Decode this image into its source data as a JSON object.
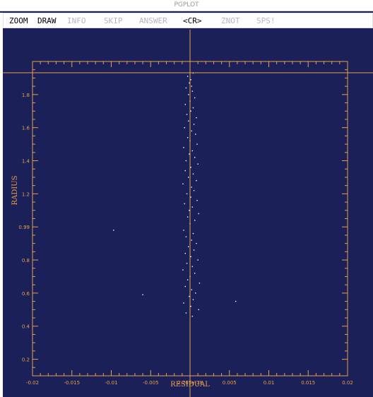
{
  "window": {
    "title": "PGPLOT"
  },
  "menu": [
    {
      "label": "ZOOM",
      "dim": false
    },
    {
      "label": "DRAW",
      "dim": false
    },
    {
      "label": "INFO",
      "dim": true
    },
    {
      "label": "SKIP",
      "dim": true
    },
    {
      "label": "ANSWER",
      "dim": true
    },
    {
      "label": "<CR>",
      "dim": false
    },
    {
      "label": "ZNOT",
      "dim": true
    },
    {
      "label": "SPS!",
      "dim": true
    }
  ],
  "chart_data": {
    "type": "scatter",
    "xlabel": "RESIDUAL",
    "ylabel": "RADIUS",
    "xlim": [
      -0.02,
      0.02
    ],
    "ylim": [
      0.1,
      2.0
    ],
    "x_tick_labels": [
      "-0.02",
      "-0.015",
      "-0.01",
      "-0.005",
      "2.765e-18",
      "0.005",
      "0.01",
      "0.015",
      "0.02"
    ],
    "y_tick_labels": [
      "0.2",
      "0.4",
      "0.6",
      "0.8",
      "0.99",
      "1.2",
      "1.4",
      "1.6",
      "1.8"
    ],
    "cursor": {
      "x": 0.0,
      "y": 2.0
    },
    "colors": {
      "background": "#1b2058",
      "axes": "#e8a04a",
      "points": "#ffffff"
    },
    "points": [
      [
        0.0004,
        1.93
      ],
      [
        -0.0003,
        1.91
      ],
      [
        0.0001,
        1.89
      ],
      [
        -0.0001,
        1.87
      ],
      [
        0.0002,
        1.85
      ],
      [
        -0.0005,
        1.84
      ],
      [
        0.0003,
        1.82
      ],
      [
        -0.0002,
        1.8
      ],
      [
        0.0006,
        1.78
      ],
      [
        0.0,
        1.76
      ],
      [
        -0.0006,
        1.74
      ],
      [
        0.0004,
        1.72
      ],
      [
        0.0001,
        1.7
      ],
      [
        -0.0004,
        1.68
      ],
      [
        0.0008,
        1.66
      ],
      [
        -0.0002,
        1.64
      ],
      [
        0.0005,
        1.62
      ],
      [
        -0.0007,
        1.6
      ],
      [
        0.0002,
        1.58
      ],
      [
        0.0007,
        1.56
      ],
      [
        -0.0003,
        1.54
      ],
      [
        0.0,
        1.52
      ],
      [
        0.0009,
        1.5
      ],
      [
        -0.0008,
        1.48
      ],
      [
        0.0003,
        1.46
      ],
      [
        -0.0001,
        1.44
      ],
      [
        0.0006,
        1.42
      ],
      [
        -0.0005,
        1.4
      ],
      [
        0.001,
        1.38
      ],
      [
        0.0001,
        1.36
      ],
      [
        -0.0006,
        1.34
      ],
      [
        0.0004,
        1.32
      ],
      [
        -0.0002,
        1.3
      ],
      [
        0.0008,
        1.28
      ],
      [
        -0.0009,
        1.26
      ],
      [
        0.0002,
        1.24
      ],
      [
        0.0005,
        1.22
      ],
      [
        -0.0004,
        1.2
      ],
      [
        0.0001,
        1.18
      ],
      [
        0.0009,
        1.16
      ],
      [
        -0.0007,
        1.14
      ],
      [
        0.0003,
        1.12
      ],
      [
        -0.0001,
        1.1
      ],
      [
        0.0011,
        1.08
      ],
      [
        -0.0003,
        1.06
      ],
      [
        0.0006,
        1.04
      ],
      [
        0.0,
        1.02
      ],
      [
        -0.0008,
        0.98
      ],
      [
        0.0004,
        0.96
      ],
      [
        -0.0005,
        0.94
      ],
      [
        0.0002,
        0.92
      ],
      [
        0.0008,
        0.9
      ],
      [
        -0.0002,
        0.88
      ],
      [
        0.0005,
        0.86
      ],
      [
        -0.0006,
        0.84
      ],
      [
        0.0001,
        0.82
      ],
      [
        0.001,
        0.8
      ],
      [
        -0.0004,
        0.78
      ],
      [
        0.0003,
        0.76
      ],
      [
        -0.0009,
        0.74
      ],
      [
        0.0006,
        0.72
      ],
      [
        0.0,
        0.7
      ],
      [
        -0.0003,
        0.68
      ],
      [
        0.0012,
        0.66
      ],
      [
        -0.0006,
        0.64
      ],
      [
        0.0002,
        0.62
      ],
      [
        0.0007,
        0.6
      ],
      [
        -0.0001,
        0.58
      ],
      [
        0.0004,
        0.56
      ],
      [
        -0.0008,
        0.54
      ],
      [
        0.0001,
        0.52
      ],
      [
        0.0011,
        0.5
      ],
      [
        -0.0005,
        0.48
      ],
      [
        0.0003,
        0.46
      ],
      [
        -0.0097,
        0.98
      ],
      [
        -0.006,
        0.59
      ],
      [
        0.0058,
        0.55
      ]
    ]
  }
}
